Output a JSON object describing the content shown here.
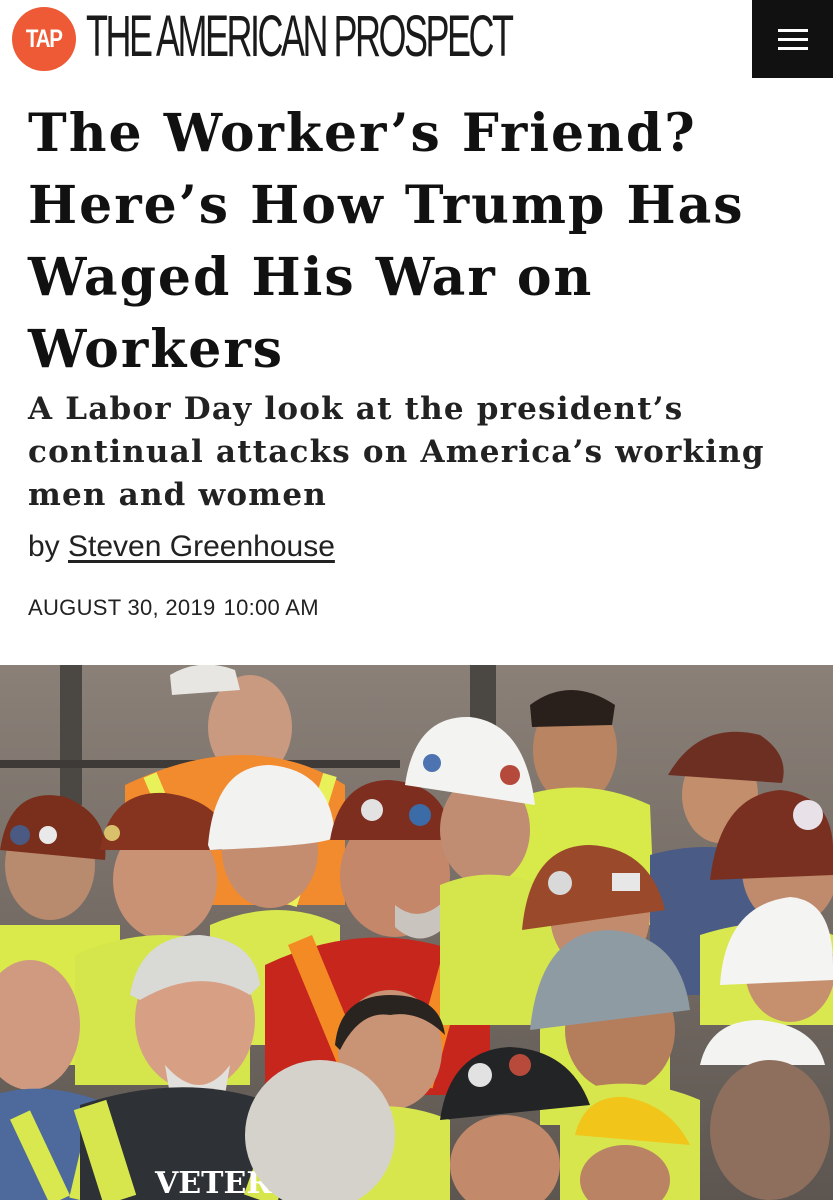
{
  "header": {
    "logo_text": "TAP",
    "site_name": "THE AMERICAN PROSPECT",
    "logo_color": "#ee5a36",
    "menu_icon": "hamburger-menu-icon"
  },
  "article": {
    "title": "The Worker’s Friend? Here’s How Trump Has Waged His War on Workers",
    "subtitle": "A Labor Day look at the president’s continual attacks on America’s working men and women",
    "byline_prefix": "by",
    "author": "Steven Greenhouse",
    "date": "AUGUST 30, 2019",
    "time": "10:00 AM"
  },
  "photo": {
    "vest_text": "VETERA"
  }
}
